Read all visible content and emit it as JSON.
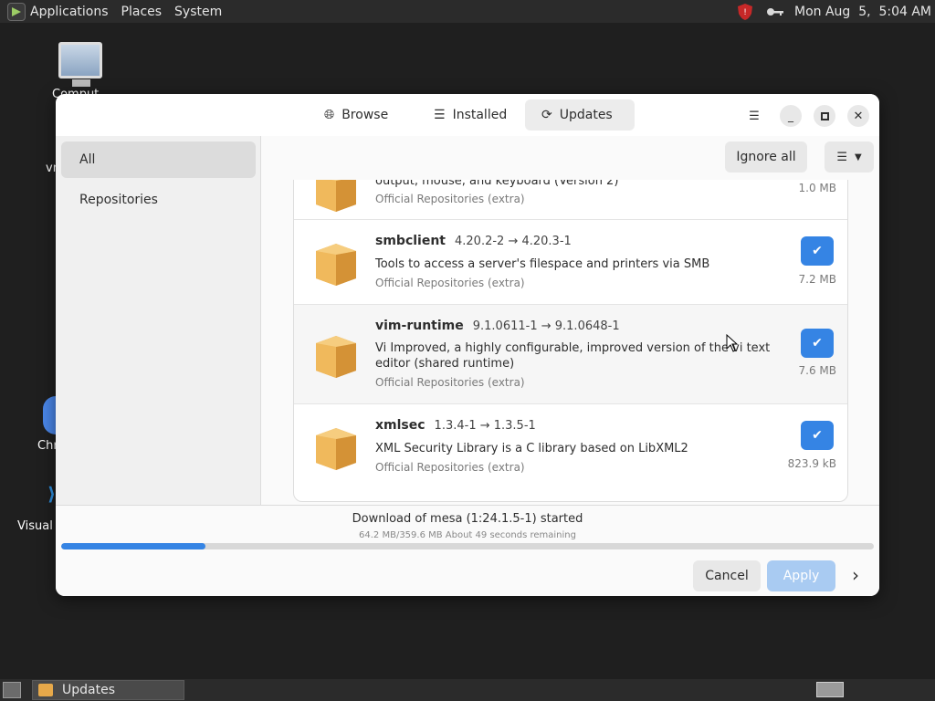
{
  "top_panel": {
    "menus": [
      "Applications",
      "Places",
      "System"
    ],
    "clock": "Mon Aug  5,  5:04 AM"
  },
  "desktop": {
    "icons": [
      {
        "label": "Comput",
        "icon": "computer-icon"
      },
      {
        "label": "vn",
        "icon": "folder-icon"
      },
      {
        "label": "Chr",
        "icon": "chrome-icon"
      },
      {
        "label": "Visual S",
        "icon": "vscode-icon"
      }
    ]
  },
  "window": {
    "tabs": [
      {
        "label": "Browse",
        "icon": "globe-icon"
      },
      {
        "label": "Installed",
        "icon": "list-icon"
      },
      {
        "label": "Updates",
        "icon": "refresh-icon",
        "active": true
      }
    ],
    "controls": [
      "menu-icon",
      "minimize-icon",
      "maximize-icon",
      "close-icon"
    ],
    "sidebar": {
      "items": [
        {
          "label": "All",
          "active": true
        },
        {
          "label": "Repositories",
          "active": false
        }
      ]
    },
    "toolbar": {
      "ignore_all": "Ignore all"
    },
    "updates": [
      {
        "name": "",
        "version": "",
        "description": "A library for portable low-level access to a video framebuffer, audio output, mouse, and keyboard (Version 2)",
        "origin": "Official Repositories (extra)",
        "size": "1.0 MB",
        "checked": true
      },
      {
        "name": "smbclient",
        "version": "4.20.2-2 → 4.20.3-1",
        "description": "Tools to access a server's filespace and printers via SMB",
        "origin": "Official Repositories (extra)",
        "size": "7.2 MB",
        "checked": true
      },
      {
        "name": "vim-runtime",
        "version": "9.1.0611-1 → 9.1.0648-1",
        "description": "Vi Improved, a highly configurable, improved version of the vi text editor (shared runtime)",
        "origin": "Official Repositories (extra)",
        "size": "7.6 MB",
        "checked": true
      },
      {
        "name": "xmlsec",
        "version": "1.3.4-1 → 1.3.5-1",
        "description": "XML Security Library is a C library based on LibXML2",
        "origin": "Official Repositories (extra)",
        "size": "823.9 kB",
        "checked": true
      }
    ],
    "status": {
      "title": "Download of mesa (1:24.1.5-1) started",
      "detail": "64.2 MB/359.6 MB About 49 seconds remaining",
      "progress": 0.178
    },
    "footer": {
      "cancel": "Cancel",
      "apply": "Apply"
    }
  },
  "taskbar": {
    "task_label": "Updates"
  },
  "colors": {
    "accent": "#3584e4",
    "apply_disabled": "#a9cbf2"
  }
}
